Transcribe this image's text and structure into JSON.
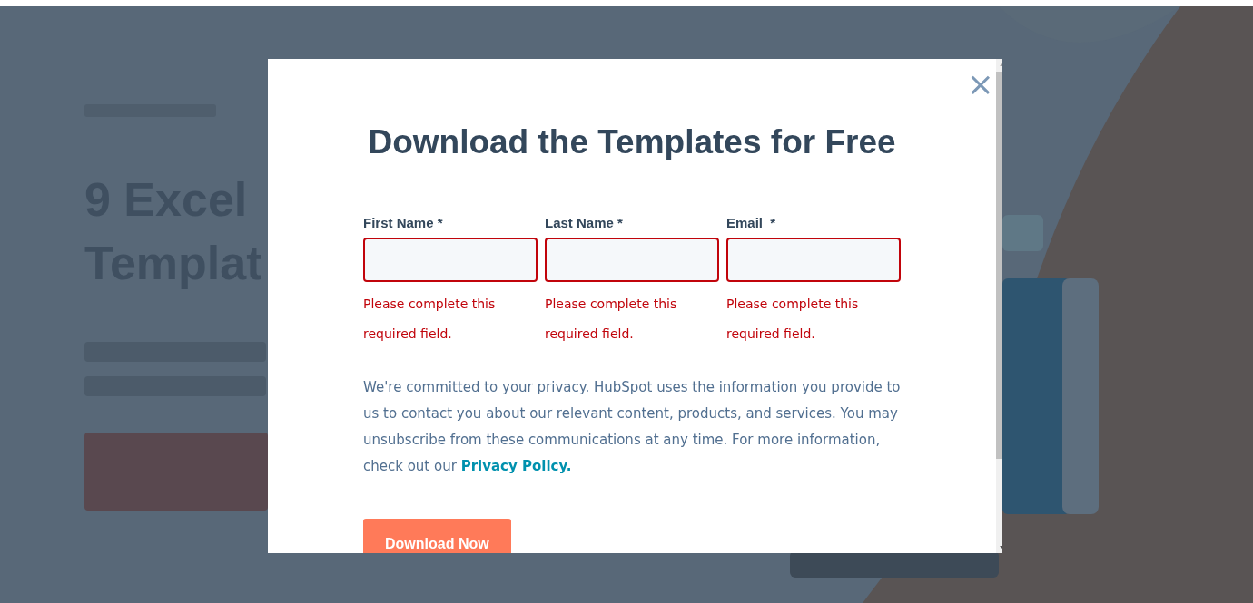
{
  "background": {
    "headline_lines": [
      "9 Excel",
      "Templat"
    ]
  },
  "modal": {
    "title": "Download the Templates for Free",
    "close": "×",
    "fields": [
      {
        "label": "First Name *",
        "error": "Please complete this required field.",
        "invalid": true
      },
      {
        "label": "Last Name *",
        "error": "Please complete this required field.",
        "invalid": true
      },
      {
        "label": "Email  *",
        "error": "Please complete this required field.",
        "invalid": true
      }
    ],
    "privacy_text": "We're committed to your privacy. HubSpot uses the information you provide to us to contact you about our relevant content, products, and services. You may unsubscribe from these communications at any time. For more information, check out our ",
    "privacy_link": "Privacy Policy.",
    "submit": "Download Now"
  }
}
